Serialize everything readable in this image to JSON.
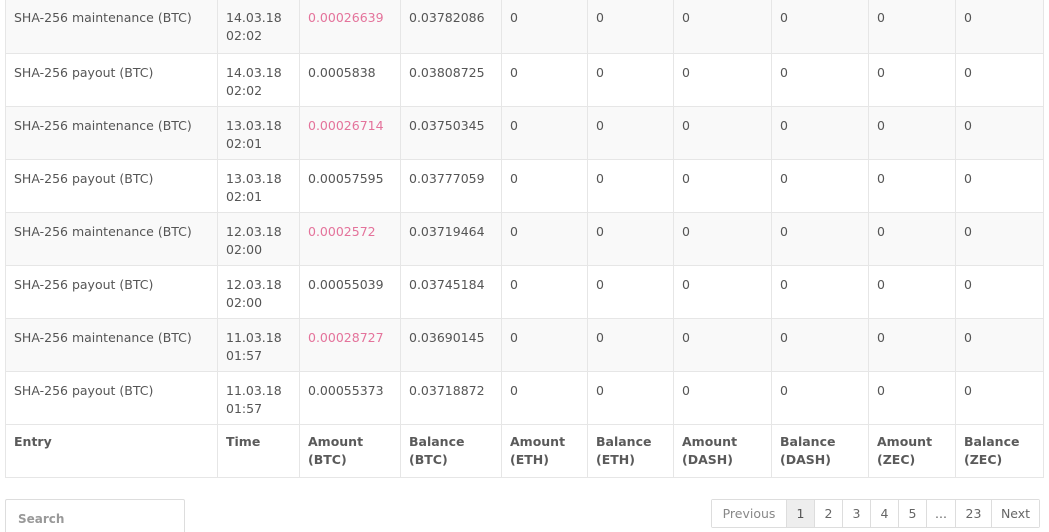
{
  "table": {
    "columns": [
      "Entry",
      "Time",
      "Amount\n(BTC)",
      "Balance\n(BTC)",
      "Amount\n(ETH)",
      "Balance\n(ETH)",
      "Amount\n(DASH)",
      "Balance\n(DASH)",
      "Amount\n(ZEC)",
      "Balance\n(ZEC)"
    ],
    "rows": [
      {
        "entry": "SHA-256 maintenance (BTC)",
        "date": "14.03.18",
        "clock": "02:02",
        "amount_btc": "0.00026639",
        "negative": true,
        "balance_btc": "0.03782086",
        "amount_eth": "0",
        "balance_eth": "0",
        "amount_dash": "0",
        "balance_dash": "0",
        "amount_zec": "0",
        "balance_zec": "0"
      },
      {
        "entry": "SHA-256 payout (BTC)",
        "date": "14.03.18",
        "clock": "02:02",
        "amount_btc": "0.0005838",
        "negative": false,
        "balance_btc": "0.03808725",
        "amount_eth": "0",
        "balance_eth": "0",
        "amount_dash": "0",
        "balance_dash": "0",
        "amount_zec": "0",
        "balance_zec": "0"
      },
      {
        "entry": "SHA-256 maintenance (BTC)",
        "date": "13.03.18",
        "clock": "02:01",
        "amount_btc": "0.00026714",
        "negative": true,
        "balance_btc": "0.03750345",
        "amount_eth": "0",
        "balance_eth": "0",
        "amount_dash": "0",
        "balance_dash": "0",
        "amount_zec": "0",
        "balance_zec": "0"
      },
      {
        "entry": "SHA-256 payout (BTC)",
        "date": "13.03.18",
        "clock": "02:01",
        "amount_btc": "0.00057595",
        "negative": false,
        "balance_btc": "0.03777059",
        "amount_eth": "0",
        "balance_eth": "0",
        "amount_dash": "0",
        "balance_dash": "0",
        "amount_zec": "0",
        "balance_zec": "0"
      },
      {
        "entry": "SHA-256 maintenance (BTC)",
        "date": "12.03.18",
        "clock": "02:00",
        "amount_btc": "0.0002572",
        "negative": true,
        "balance_btc": "0.03719464",
        "amount_eth": "0",
        "balance_eth": "0",
        "amount_dash": "0",
        "balance_dash": "0",
        "amount_zec": "0",
        "balance_zec": "0"
      },
      {
        "entry": "SHA-256 payout (BTC)",
        "date": "12.03.18",
        "clock": "02:00",
        "amount_btc": "0.00055039",
        "negative": false,
        "balance_btc": "0.03745184",
        "amount_eth": "0",
        "balance_eth": "0",
        "amount_dash": "0",
        "balance_dash": "0",
        "amount_zec": "0",
        "balance_zec": "0"
      },
      {
        "entry": "SHA-256 maintenance (BTC)",
        "date": "11.03.18",
        "clock": "01:57",
        "amount_btc": "0.00028727",
        "negative": true,
        "balance_btc": "0.03690145",
        "amount_eth": "0",
        "balance_eth": "0",
        "amount_dash": "0",
        "balance_dash": "0",
        "amount_zec": "0",
        "balance_zec": "0"
      },
      {
        "entry": "SHA-256 payout (BTC)",
        "date": "11.03.18",
        "clock": "01:57",
        "amount_btc": "0.00055373",
        "negative": false,
        "balance_btc": "0.03718872",
        "amount_eth": "0",
        "balance_eth": "0",
        "amount_dash": "0",
        "balance_dash": "0",
        "amount_zec": "0",
        "balance_zec": "0"
      }
    ]
  },
  "search": {
    "placeholder": "Search",
    "value": ""
  },
  "pagination": {
    "items": [
      "Previous",
      "1",
      "2",
      "3",
      "4",
      "5",
      "...",
      "23",
      "Next"
    ],
    "active": "1"
  },
  "colors": {
    "negative_amount": "#e4739b",
    "row_stripe": "#f9f9f9",
    "border": "#e6e6e6"
  }
}
